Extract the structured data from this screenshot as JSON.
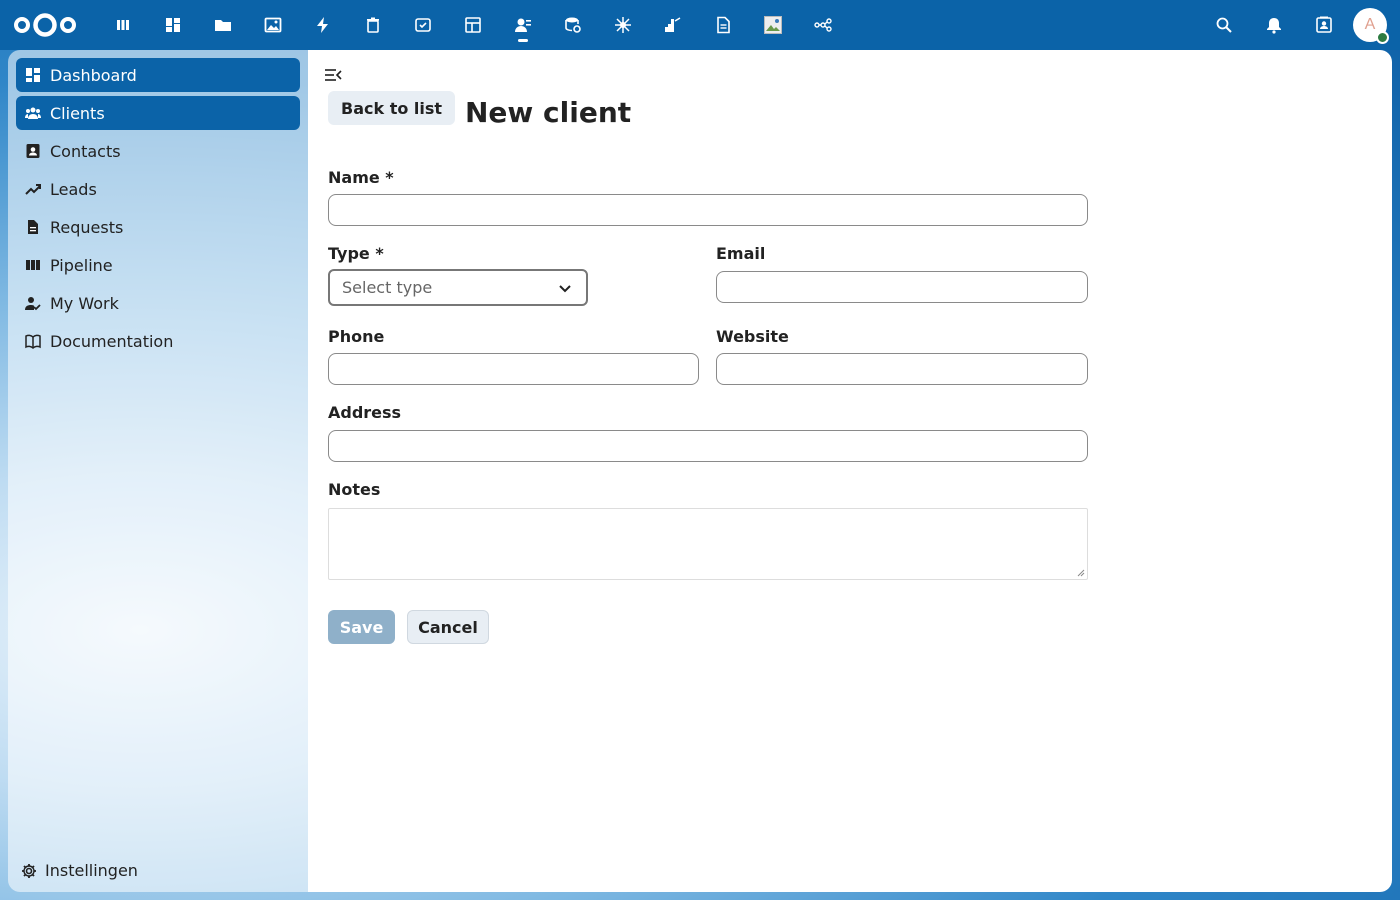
{
  "header": {
    "apps": [
      {
        "name": "deck-icon"
      },
      {
        "name": "dashboard-icon"
      },
      {
        "name": "files-icon"
      },
      {
        "name": "photos-icon"
      },
      {
        "name": "activity-icon"
      },
      {
        "name": "trash-icon"
      },
      {
        "name": "forms-icon"
      },
      {
        "name": "tables-icon"
      },
      {
        "name": "contacts-icon"
      },
      {
        "name": "database-icon"
      },
      {
        "name": "integration-icon"
      },
      {
        "name": "analytics-icon"
      },
      {
        "name": "text-icon"
      },
      {
        "name": "image-icon"
      },
      {
        "name": "flow-icon"
      }
    ],
    "active_app_index": 8,
    "avatar_initial": "A"
  },
  "sidebar": {
    "items": [
      {
        "label": "Dashboard",
        "icon": "dashboard-icon",
        "active": true
      },
      {
        "label": "Clients",
        "icon": "clients-icon",
        "active": true
      },
      {
        "label": "Contacts",
        "icon": "contact-card-icon",
        "active": false
      },
      {
        "label": "Leads",
        "icon": "trending-up-icon",
        "active": false
      },
      {
        "label": "Requests",
        "icon": "document-icon",
        "active": false
      },
      {
        "label": "Pipeline",
        "icon": "columns-icon",
        "active": false
      },
      {
        "label": "My Work",
        "icon": "user-check-icon",
        "active": false
      },
      {
        "label": "Documentation",
        "icon": "book-icon",
        "active": false
      }
    ],
    "settings_label": "Instellingen"
  },
  "main": {
    "back_label": "Back to list",
    "title": "New client",
    "fields": {
      "name_label": "Name *",
      "name_value": "",
      "type_label": "Type *",
      "type_placeholder": "Select type",
      "email_label": "Email",
      "email_value": "",
      "phone_label": "Phone",
      "phone_value": "",
      "website_label": "Website",
      "website_value": "",
      "address_label": "Address",
      "address_value": "",
      "notes_label": "Notes"
    },
    "save_label": "Save",
    "cancel_label": "Cancel"
  },
  "colors": {
    "header_bg": "#0b63a8",
    "accent": "#0b63a8",
    "save_disabled": "#8fb0c9",
    "status_online": "#2d7b41"
  }
}
